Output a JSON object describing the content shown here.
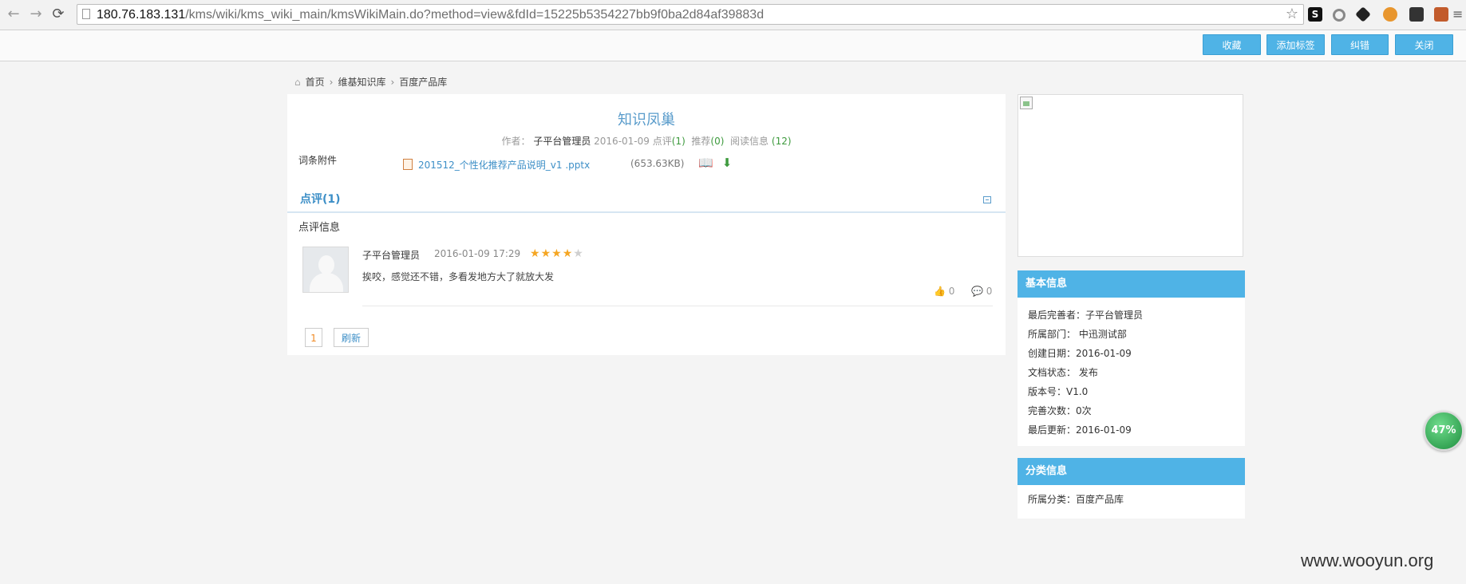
{
  "browser": {
    "url_host": "180.76.183.131",
    "url_path": "/kms/wiki/kms_wiki_main/kmsWikiMain.do?method=view&fdId=15225b5354227bb9f0ba2d84af39883d"
  },
  "actions": {
    "favorite": "收藏",
    "add_tag": "添加标签",
    "correct": "纠错",
    "close": "关闭"
  },
  "breadcrumb": {
    "home": "首页",
    "wiki": "维基知识库",
    "category": "百度产品库"
  },
  "doc": {
    "title": "知识凤巢",
    "author_label": "作者：",
    "author": "子平台管理员",
    "date": "2016-01-09",
    "comment_label": "点评",
    "comment_count": "(1)",
    "recommend_label": "推荐",
    "recommend_count": "(0)",
    "read_label": "阅读信息",
    "read_count": "(12)"
  },
  "attachment": {
    "label": "词条附件",
    "file_name": "201512_个性化推荐产品说明_v1 .pptx",
    "file_size": "(653.63KB)"
  },
  "comments": {
    "section_title": "点评(1)",
    "subheading": "点评信息",
    "items": [
      {
        "author": "子平台管理员",
        "time": "2016-01-09 17:29",
        "rating": 4,
        "text": "挨咬，感觉还不错，多看发地方大了就放大发",
        "likes": "0",
        "replies": "0"
      }
    ]
  },
  "pager": {
    "page": "1",
    "refresh": "刷新"
  },
  "basic_info": {
    "title": "基本信息",
    "rows": [
      "最后完善者：子平台管理员",
      "所属部门： 中迅测试部",
      "创建日期：2016-01-09",
      "文档状态： 发布",
      "版本号：V1.0",
      "完善次数：0次",
      "最后更新：2016-01-09"
    ]
  },
  "category_info": {
    "title": "分类信息",
    "rows": [
      "所属分类：百度产品库"
    ]
  },
  "widget": {
    "percent": "47%"
  },
  "watermark": "www.wooyun.org",
  "colors": {
    "accent": "#4fb3e6",
    "link": "#3d8fc7",
    "star": "#f5a623"
  }
}
